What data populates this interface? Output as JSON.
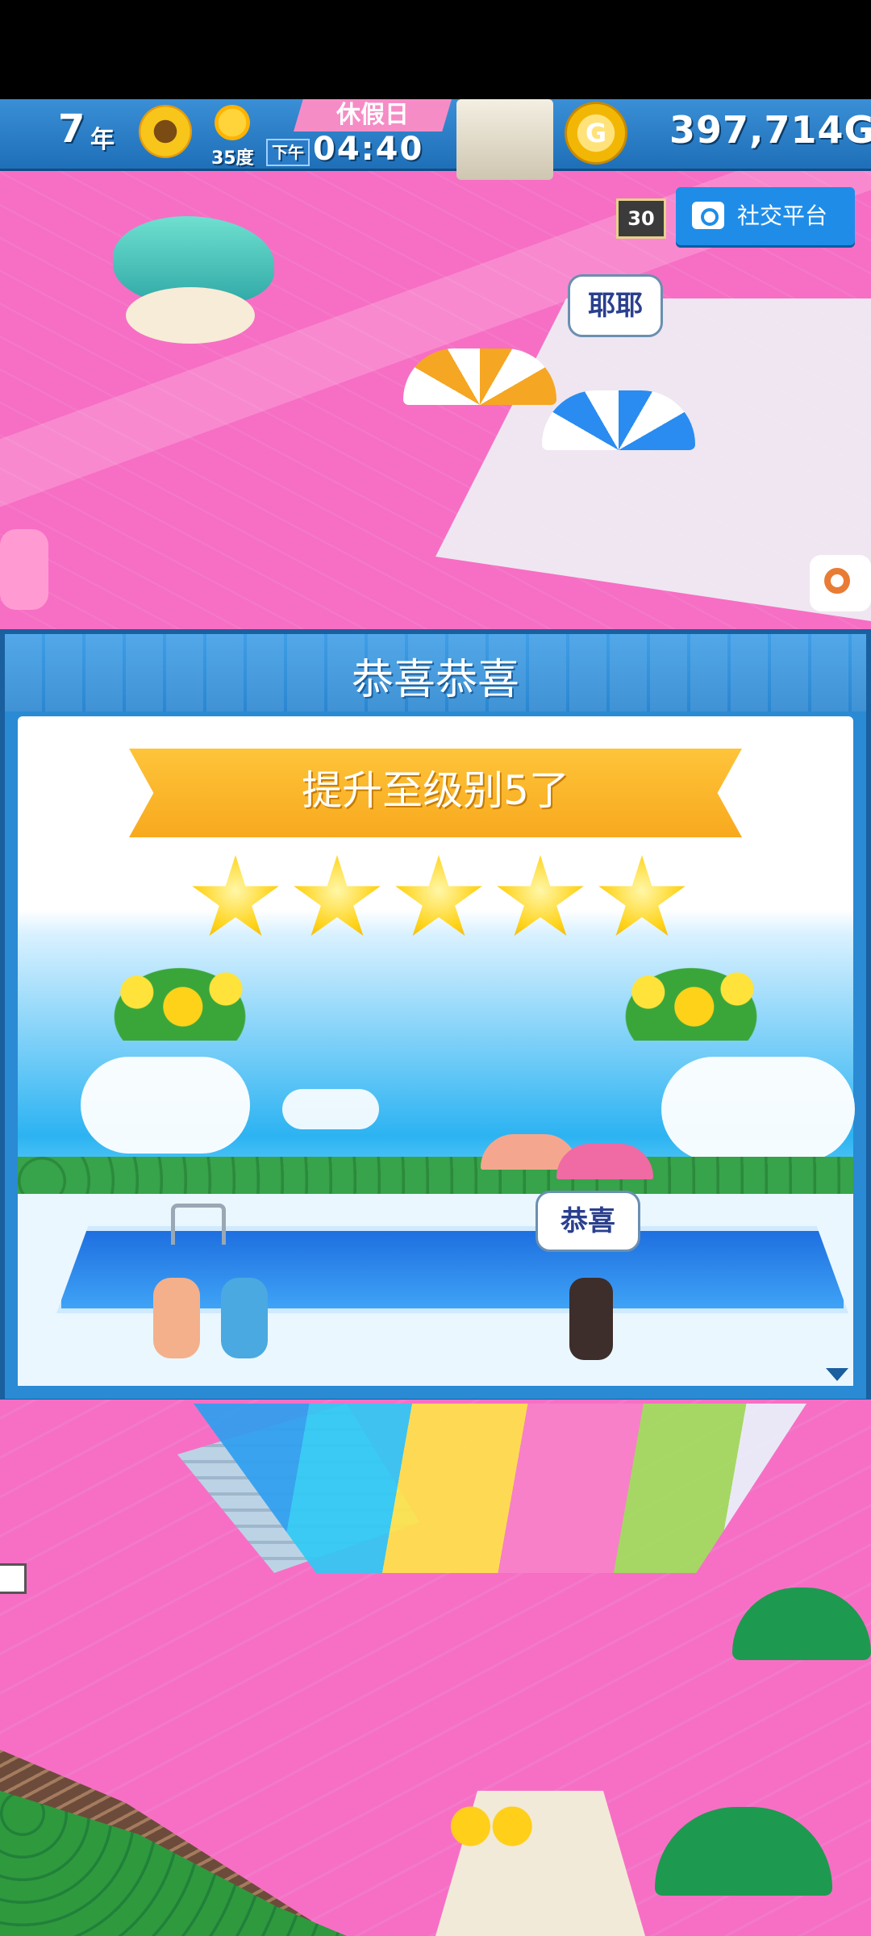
{
  "hud": {
    "year_number": "7",
    "year_unit": "年",
    "temperature": "35度",
    "holiday": "休假日",
    "ampm": "下午",
    "time": "04:40",
    "coin_symbol": "G",
    "money": "397,714G",
    "icons": [
      "sunflower-icon",
      "sun-icon",
      "gold-coin-icon"
    ]
  },
  "overlay": {
    "day_counter_badge": "30",
    "social_button_label": "社交平台",
    "speech_bubble_top": "耶耶"
  },
  "popup": {
    "title": "恭喜恭喜",
    "ribbon_text": "提升至级别5了",
    "stars_shown": 5,
    "stars_total": 5,
    "speech_bubble": "恭喜"
  },
  "colors": {
    "hud_blue": "#1e6fb8",
    "popup_blue": "#2a8ad4",
    "ribbon_yellow": "#fec43a",
    "floor_pink": "#f66fc4",
    "social_blue": "#1f8de8"
  }
}
